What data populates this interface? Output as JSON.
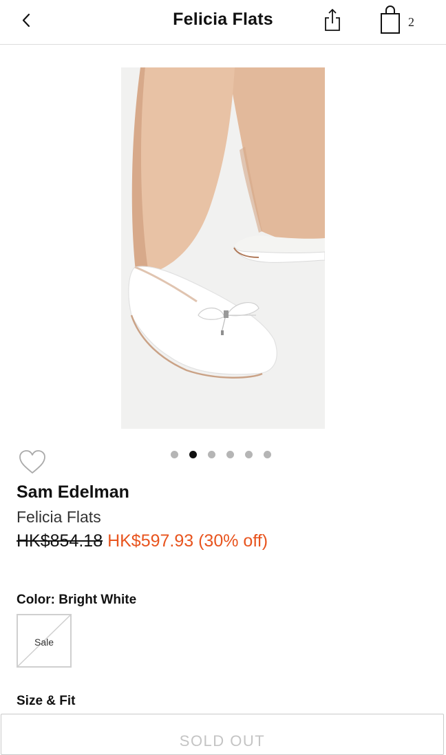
{
  "header": {
    "title": "Felicia Flats",
    "bag_count": "2",
    "back_icon": "chevron-left-icon",
    "share_icon": "share-icon",
    "bag_icon": "shopping-bag-icon"
  },
  "gallery": {
    "image_description": "white ballet flat",
    "active_index": 1,
    "count": 6
  },
  "product": {
    "brand": "Sam Edelman",
    "name": "Felicia Flats",
    "original_price": "HK$854.18",
    "sale_price": "HK$597.93 (30% off)"
  },
  "color": {
    "label": "Color: Bright White",
    "swatch_label": "Sale"
  },
  "size": {
    "label": "Size & Fit"
  },
  "cta": {
    "label": "SOLD OUT"
  },
  "colors": {
    "sale": "#e8541e",
    "dot_active": "#111111",
    "dot_inactive": "#b5b5b5"
  }
}
